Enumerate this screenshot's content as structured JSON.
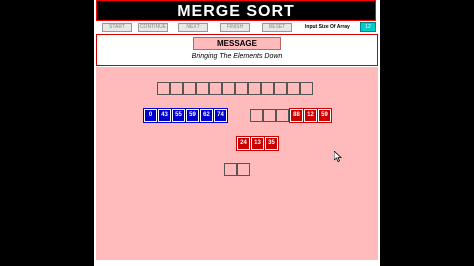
{
  "app": {
    "title": "MERGE  SORT"
  },
  "controls": {
    "buttons": [
      "START",
      "CONTINUE",
      "NEXT",
      "FINISH",
      "RESET"
    ],
    "size_label": "Input Size Of Array",
    "size_value": "12"
  },
  "message": {
    "header": "MESSAGE",
    "text": "Bringing The Elements Down"
  },
  "arrays": {
    "left_values": [
      "0",
      "43",
      "55",
      "59",
      "62",
      "74"
    ],
    "right_values": [
      "88",
      "12",
      "59"
    ],
    "third_values": [
      "24",
      "13",
      "35"
    ]
  },
  "colors": {
    "blue": "#0000cc",
    "red": "#cc0000",
    "canvas": "#ffbbbb"
  }
}
